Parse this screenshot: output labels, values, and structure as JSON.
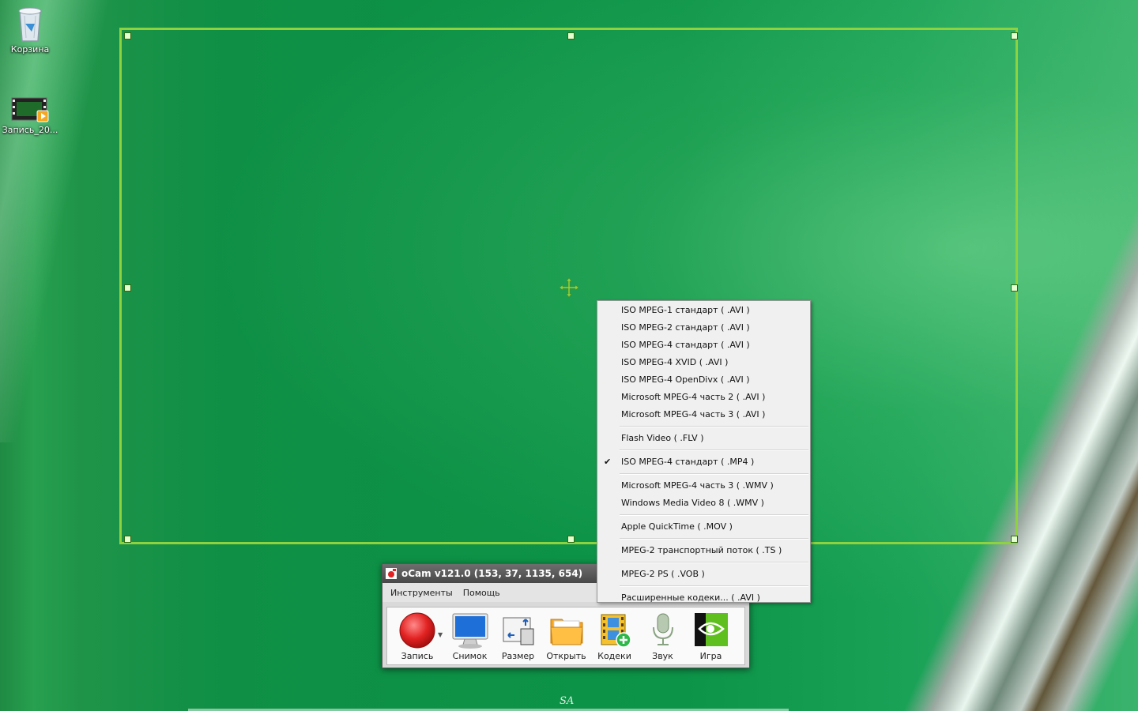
{
  "desktop": {
    "icons": [
      {
        "label": "Корзина",
        "icon": "recycle-bin-icon"
      },
      {
        "label": "Запись_20...",
        "icon": "video-file-icon"
      }
    ],
    "watermark": "SA"
  },
  "ocam": {
    "title": "oCam v121.0 (153, 37, 1135, 654)",
    "menu": [
      "Инструменты",
      "Помощь"
    ],
    "tools": [
      {
        "label": "Запись",
        "icon": "record-icon"
      },
      {
        "label": "Снимок",
        "icon": "monitor-icon"
      },
      {
        "label": "Размер",
        "icon": "resize-icon"
      },
      {
        "label": "Открыть",
        "icon": "folder-icon"
      },
      {
        "label": "Кодеки",
        "icon": "codecs-icon"
      },
      {
        "label": "Звук",
        "icon": "microphone-icon"
      },
      {
        "label": "Игра",
        "icon": "nvidia-game-icon"
      }
    ]
  },
  "codec_menu": {
    "items": [
      "ISO MPEG-1 стандарт ( .AVI )",
      "ISO MPEG-2 стандарт ( .AVI )",
      "ISO MPEG-4 стандарт ( .AVI )",
      "ISO MPEG-4 XVID ( .AVI )",
      "ISO MPEG-4 OpenDivx ( .AVI )",
      "Microsoft MPEG-4 часть 2 ( .AVI )",
      "Microsoft MPEG-4 часть 3 ( .AVI )",
      "Flash Video ( .FLV )",
      "ISO MPEG-4 стандарт ( .MP4 )",
      "Microsoft MPEG-4 часть 3 ( .WMV )",
      "Windows Media Video 8 ( .WMV )",
      "Apple QuickTime ( .MOV )",
      "MPEG-2 транспортный поток ( .TS )",
      "MPEG-2 PS ( .VOB )",
      "Расширенные кодеки... ( .AVI )"
    ],
    "checked": "ISO MPEG-4 стандарт ( .MP4 )"
  },
  "colors": {
    "frame": "#8fd23f",
    "record": "#e22222"
  }
}
